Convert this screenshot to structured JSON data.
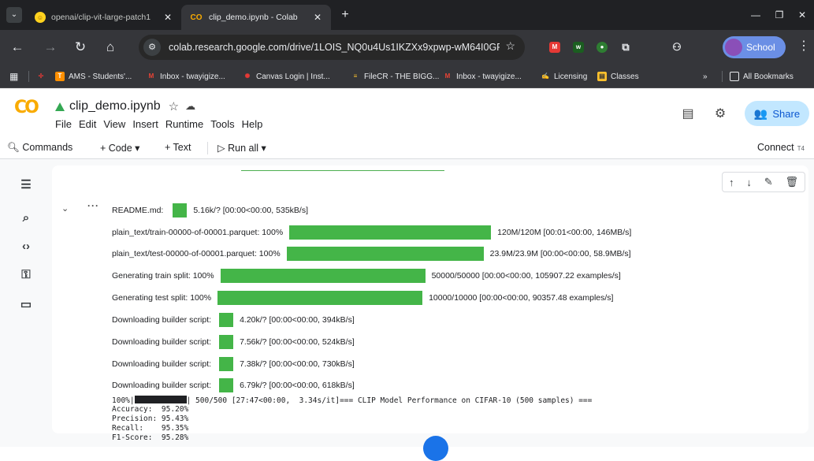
{
  "browser": {
    "tabs": [
      {
        "label": "openai/clip-vit-large-patch1",
        "icon": "huggingface-icon",
        "active": false
      },
      {
        "label": "clip_demo.ipynb - Colab",
        "icon": "colab-icon",
        "active": true
      }
    ],
    "new_tab": "+",
    "url": "colab.research.google.com/drive/1LOIS_NQ0u4Us1IKZXx9xpwp-wM64I0GF...",
    "profile_label": "School",
    "bookmarks": [
      "AMS - Students'...",
      "Inbox - twayigize...",
      "Canvas Login | Inst...",
      "FileCR - THE BIGG...",
      "Inbox - twayigize...",
      "Licensing",
      "Classes"
    ],
    "all_bookmarks": "All Bookmarks",
    "overflow": "»"
  },
  "colab": {
    "logo": "CO",
    "notebook_title": "clip_demo.ipynb",
    "menu": [
      "File",
      "Edit",
      "View",
      "Insert",
      "Runtime",
      "Tools",
      "Help"
    ],
    "share_label": "Share",
    "commands_label": "Commands",
    "add_code": "+ Code",
    "add_text": "+ Text",
    "run_all": "Run all",
    "connect_label": "Connect",
    "runtime_badge": "T4"
  },
  "output": {
    "progress_rows": [
      {
        "label": "README.md:",
        "stats": "5.16k/? [00:00<00:00, 535kB/s]",
        "fill": 1.0
      },
      {
        "label": "plain_text/train-00000-of-00001.parquet: 100%",
        "stats": "120M/120M [00:01<00:00, 146MB/s]",
        "fill": 1.0
      },
      {
        "label": "plain_text/test-00000-of-00001.parquet: 100%",
        "stats": "23.9M/23.9M [00:00<00:00, 58.9MB/s]",
        "fill": 1.0
      },
      {
        "label": "Generating train split: 100%",
        "stats": "50000/50000 [00:00<00:00, 105907.22 examples/s]",
        "fill": 1.0
      },
      {
        "label": "Generating test split: 100%",
        "stats": "10000/10000 [00:00<00:00, 90357.48 examples/s]",
        "fill": 1.0
      },
      {
        "label": "Downloading builder script:",
        "stats": "4.20k/? [00:00<00:00, 394kB/s]",
        "fill": 1.0
      },
      {
        "label": "Downloading builder script:",
        "stats": "7.56k/? [00:00<00:00, 524kB/s]",
        "fill": 1.0
      },
      {
        "label": "Downloading builder script:",
        "stats": "7.38k/? [00:00<00:00, 730kB/s]",
        "fill": 1.0
      },
      {
        "label": "Downloading builder script:",
        "stats": "6.79k/? [00:00<00:00, 618kB/s]",
        "fill": 1.0
      }
    ],
    "final_prefix": "100%|",
    "final_suffix": "| 500/500 [27:47<00:00,  3.34s/it]=== CLIP Model Performance on CIFAR-10 (500 samples) ===",
    "metrics": [
      "Accuracy:  95.20%",
      "Precision: 95.43%",
      "Recall:    95.35%",
      "F1-Score:  95.28%"
    ]
  },
  "colors": {
    "progress_green": "#44b548",
    "share_bg": "#c2e7ff",
    "colab_orange": "#f9ab00",
    "chrome_dark": "#202124"
  }
}
